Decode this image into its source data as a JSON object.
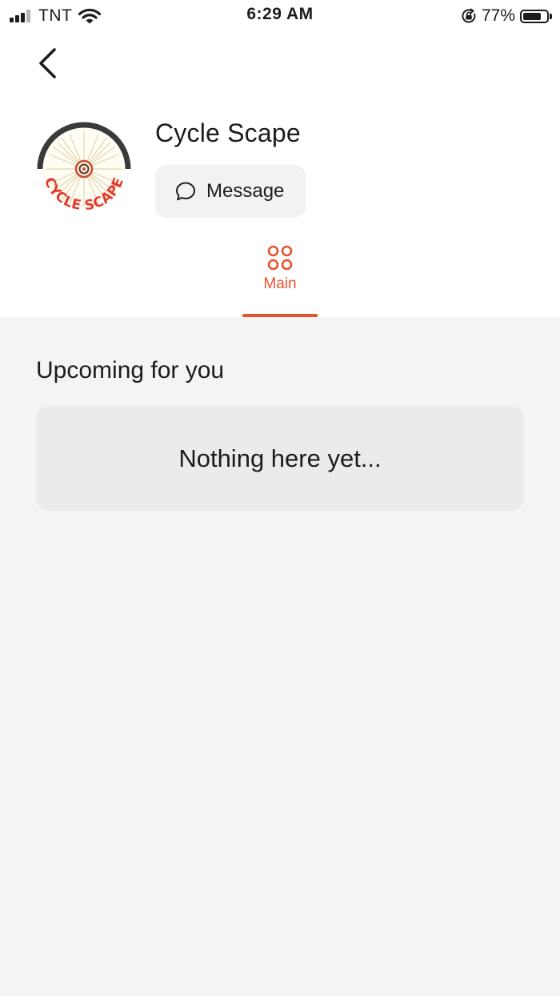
{
  "status_bar": {
    "carrier": "TNT",
    "time": "6:29 AM",
    "battery_percent": "77%",
    "battery_level": 0.77,
    "signal_bars_filled": 3,
    "icons": [
      "signal-icon",
      "wifi-icon",
      "orientation-lock-icon",
      "battery-icon"
    ]
  },
  "nav": {
    "back_icon": "chevron-left-icon"
  },
  "profile": {
    "name": "Cycle Scape",
    "logo_text": "CYCLE SCAPE",
    "message_label": "Message",
    "message_icon": "chat-bubble-icon"
  },
  "tabs": [
    {
      "label": "Main",
      "icon": "grid-icon",
      "active": true
    }
  ],
  "main": {
    "section_title": "Upcoming for you",
    "empty_message": "Nothing here yet..."
  },
  "colors": {
    "accent": "#e8532b",
    "background": "#f4f4f4",
    "header_background": "#ffffff",
    "card_background": "#ebebeb",
    "text": "#1c1c1c"
  }
}
